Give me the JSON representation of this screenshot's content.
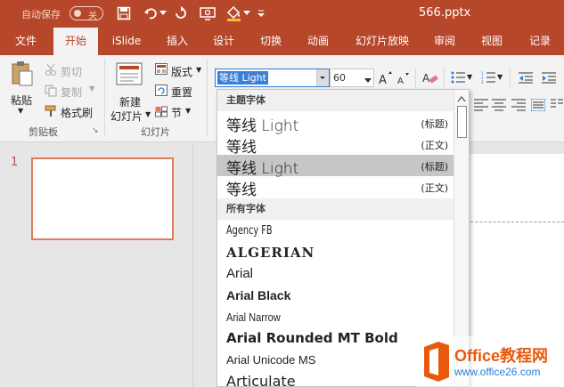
{
  "titlebar": {
    "autosave_label": "自动保存",
    "autosave_state": "关",
    "filename": "566.pptx"
  },
  "tabs": [
    "文件",
    "开始",
    "iSlide",
    "插入",
    "设计",
    "切换",
    "动画",
    "幻灯片放映",
    "审阅",
    "视图",
    "记录"
  ],
  "active_tab": "开始",
  "ribbon": {
    "clipboard": {
      "paste": "粘贴",
      "cut": "剪切",
      "copy": "复制",
      "format_painter": "格式刷",
      "group_label": "剪贴板"
    },
    "slides": {
      "new_slide_1": "新建",
      "new_slide_2": "幻灯片",
      "layout": "版式",
      "reset": "重置",
      "section": "节",
      "group_label": "幻灯片"
    },
    "font": {
      "font_name": "等线 Light",
      "font_size": "60"
    }
  },
  "thumbnails": {
    "slide_number": "1"
  },
  "font_dropdown": {
    "theme_header": "主题字体",
    "theme_fonts": [
      {
        "name": "等线 Light",
        "tag": "(标题)"
      },
      {
        "name": "等线",
        "tag": "(正文)"
      },
      {
        "name": "等线 Light",
        "tag": "(标题)"
      },
      {
        "name": "等线",
        "tag": "(正文)"
      }
    ],
    "all_header": "所有字体",
    "all_fonts": [
      "Agency FB",
      "ALGERIAN",
      "Arial",
      "Arial Black",
      "Arial Narrow",
      "Arial Rounded MT Bold",
      "Arial Unicode MS",
      "Articulate"
    ]
  },
  "watermark": {
    "title": "Office教程网",
    "url": "www.office26.com"
  },
  "colors": {
    "accent": "#b7472a",
    "selection": "#3c7fd6",
    "highlight_row": "#c6c6c6",
    "watermark_orange": "#e8590c"
  }
}
